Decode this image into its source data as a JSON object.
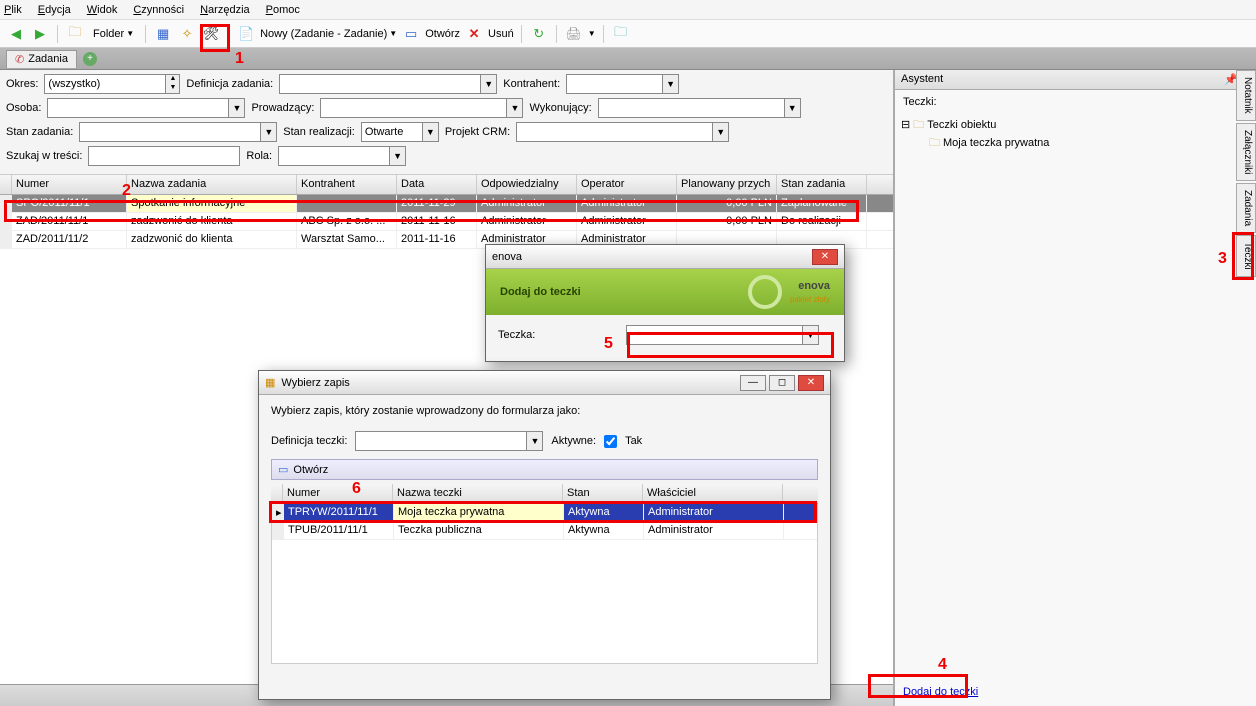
{
  "menu": {
    "plik": "Plik",
    "edycja": "Edycja",
    "widok": "Widok",
    "czynnosci": "Czynności",
    "narzedzia": "Narzędzia",
    "pomoc": "Pomoc"
  },
  "toolbar": {
    "folder": "Folder",
    "nowy": "Nowy (Zadanie - Zadanie)",
    "otworz": "Otwórz",
    "usun": "Usuń"
  },
  "tab": {
    "zadania": "Zadania"
  },
  "filters": {
    "okres_label": "Okres:",
    "okres_value": "(wszystko)",
    "defz_label": "Definicja zadania:",
    "defz_value": "",
    "kontr_label": "Kontrahent:",
    "kontr_value": "",
    "osoba_label": "Osoba:",
    "osoba_value": "",
    "prow_label": "Prowadzący:",
    "prow_value": "",
    "wyk_label": "Wykonujący:",
    "wyk_value": "",
    "stanz_label": "Stan zadania:",
    "stanz_value": "",
    "stanr_label": "Stan realizacji:",
    "stanr_value": "Otwarte",
    "proj_label": "Projekt CRM:",
    "proj_value": "",
    "szukaj_label": "Szukaj w treści:",
    "szukaj_value": "",
    "rola_label": "Rola:",
    "rola_value": ""
  },
  "grid": {
    "headers": {
      "numer": "Numer",
      "nazwa": "Nazwa zadania",
      "kontr": "Kontrahent",
      "data": "Data",
      "odp": "Odpowiedzialny",
      "op": "Operator",
      "plan": "Planowany przych",
      "stan": "Stan zadania"
    },
    "rows": [
      {
        "numer": "SPO/2011/11/1",
        "nazwa": "Spotkanie informacyjne",
        "kontr": "",
        "data": "2011-11-29",
        "odp": "Administrator",
        "op": "Administrator",
        "plan": "0,00 PLN",
        "stan": "Zaplanowane",
        "sel": true
      },
      {
        "numer": "ZAD/2011/11/1",
        "nazwa": "zadzwonić do klienta",
        "kontr": "ABC Sp. z o.o. ...",
        "data": "2011-11-16",
        "odp": "Administrator",
        "op": "Administrator",
        "plan": "0,00 PLN",
        "stan": "Do realizacji"
      },
      {
        "numer": "ZAD/2011/11/2",
        "nazwa": "zadzwonić do klienta",
        "kontr": "Warsztat Samo...",
        "data": "2011-11-16",
        "odp": "Administrator",
        "op": "Administrator",
        "plan": "",
        "stan": ""
      }
    ]
  },
  "asystent": {
    "title": "Asystent",
    "teczki_label": "Teczki:",
    "root": "Teczki obiektu",
    "child": "Moja teczka prywatna",
    "link": "Dodaj do teczki"
  },
  "side_tabs": {
    "notatnik": "Notatnik",
    "zalaczniki": "Załączniki",
    "zadania": "Zadania",
    "teczki": "Teczki"
  },
  "dlg_add": {
    "title": "enova",
    "green": "Dodaj do teczki",
    "brand": "enova",
    "brand_sub": "pakiet złoty",
    "teczka_label": "Teczka:",
    "teczka_value": ""
  },
  "dlg_pick": {
    "title": "Wybierz zapis",
    "instr": "Wybierz zapis, który zostanie wprowadzony do formularza jako:",
    "def_label": "Definicja teczki:",
    "def_value": "",
    "akt_label": "Aktywne:",
    "akt_txt": "Tak",
    "otworz": "Otwórz",
    "headers": {
      "numer": "Numer",
      "nazwa": "Nazwa teczki",
      "stan": "Stan",
      "wlasciciel": "Właściciel"
    },
    "rows": [
      {
        "numer": "TPRYW/2011/11/1",
        "nazwa": "Moja teczka prywatna",
        "stan": "Aktywna",
        "wl": "Administrator",
        "sel": true
      },
      {
        "numer": "TPUB/2011/11/1",
        "nazwa": "Teczka publiczna",
        "stan": "Aktywna",
        "wl": "Administrator"
      }
    ]
  },
  "markers": {
    "1": "1",
    "2": "2",
    "3": "3",
    "4": "4",
    "5": "5",
    "6": "6"
  }
}
